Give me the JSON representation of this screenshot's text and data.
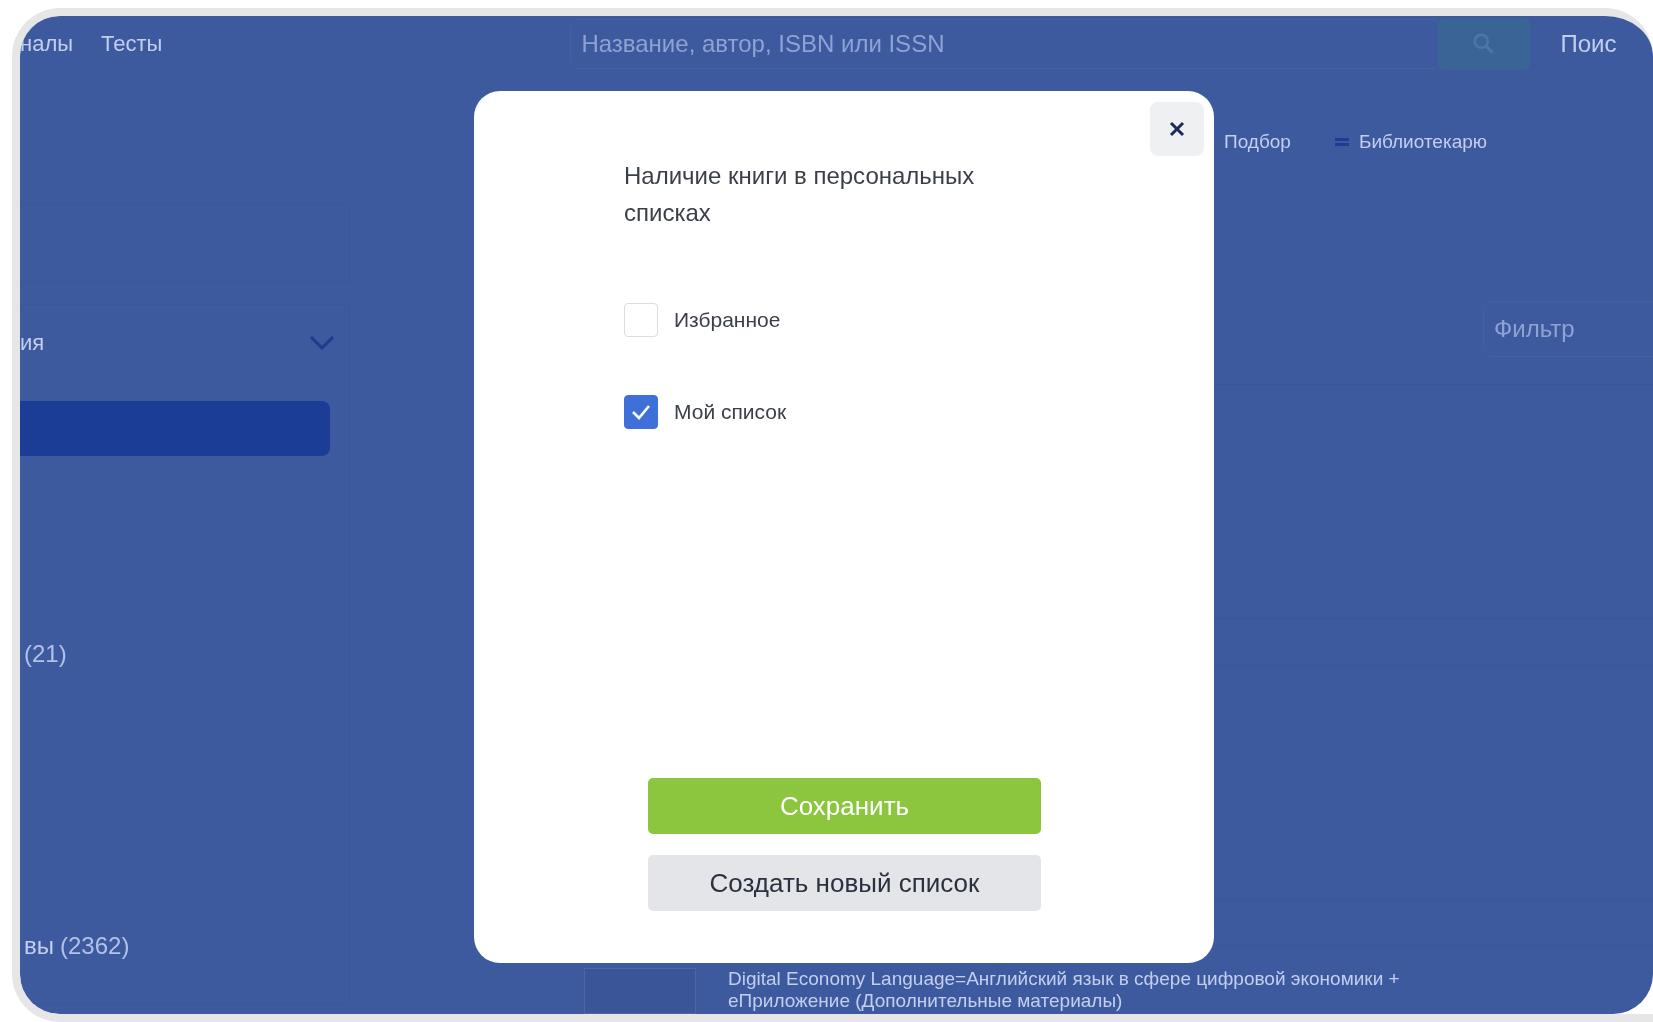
{
  "background": {
    "nav_links": [
      "налы",
      "Тесты"
    ],
    "search": {
      "placeholder": "Название, автор, ISBN или ISSN"
    },
    "search_label": "Поис",
    "toolbar_links": [
      "Подбор",
      "Библиотекарю"
    ],
    "sidebar": {
      "dropdown_label": "ия",
      "items": [
        {
          "count": "(21)"
        },
        {
          "label": "вы",
          "count": "(2362)"
        }
      ]
    },
    "filter": {
      "placeholder": "Фильтр"
    },
    "book": {
      "title": "Digital Economy Language=Английский язык в сфере цифровой экономики + еПриложение (Дополнительные материалы)"
    }
  },
  "modal": {
    "title": "Наличие книги в персональных списках",
    "lists": [
      {
        "label": "Избранное",
        "checked": false
      },
      {
        "label": "Мой список",
        "checked": true
      }
    ],
    "save_button": "Сохранить",
    "create_button": "Создать новый список"
  }
}
